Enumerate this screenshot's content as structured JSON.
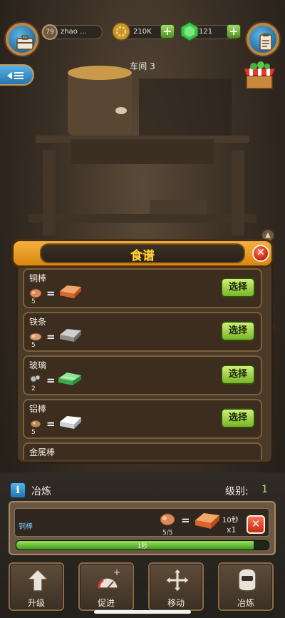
{
  "topbar": {
    "player_level": "79",
    "player_name": "zhao ...",
    "coins": "210K",
    "gems": "121"
  },
  "workshop_label": "车间 3",
  "side_number": "3",
  "recipe_panel": {
    "title": "食谱",
    "items": [
      {
        "name": "铜棒",
        "count": "5",
        "select_label": "选择",
        "input_color": "#d98a5a",
        "output_color": "#e07a3a"
      },
      {
        "name": "铁条",
        "count": "5",
        "select_label": "选择",
        "input_color": "#d9a07a",
        "output_color": "#a9a9a9"
      },
      {
        "name": "玻璃",
        "count": "2",
        "select_label": "选择",
        "input_color": "#b8bcc0",
        "output_color": "#5cc36a"
      },
      {
        "name": "铝棒",
        "count": "5",
        "select_label": "选择",
        "input_color": "#b8895a",
        "output_color": "#e8eef2"
      },
      {
        "name": "金属棒"
      }
    ]
  },
  "smelting": {
    "title": "冶炼",
    "level_label": "级别:",
    "level_value": "1",
    "task": {
      "name": "铜棒",
      "count": "5/5",
      "time": "10秒",
      "multiplier": "x1",
      "progress_fraction": 0.94,
      "progress_label": "1秒"
    }
  },
  "bottom_buttons": [
    {
      "label": "升级",
      "icon": "upgrade-arrow-icon"
    },
    {
      "label": "促进",
      "icon": "boost-gauge-icon"
    },
    {
      "label": "移动",
      "icon": "move-arrows-icon"
    },
    {
      "label": "冶炼",
      "icon": "smelter-mask-icon"
    }
  ],
  "colors": {
    "accent_orange": "#f5b13c",
    "select_green": "#9fd94a",
    "close_red": "#d9331a",
    "title_yellow": "#ffd53d"
  }
}
